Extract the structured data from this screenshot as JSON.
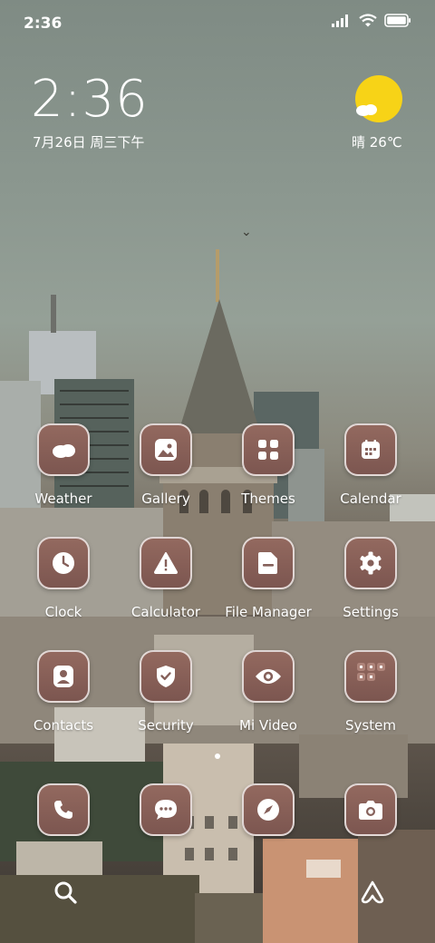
{
  "status_bar": {
    "time": "2:36",
    "battery_level": 1.0
  },
  "clock_widget": {
    "time": "2:36",
    "date": "7月26日 周三下午"
  },
  "weather_widget": {
    "text": "晴 26℃",
    "icon": "sun-cloud-icon",
    "sun_color": "#f7d317"
  },
  "apps": [
    {
      "label": "Weather",
      "icon": "cloud-icon"
    },
    {
      "label": "Gallery",
      "icon": "image-icon"
    },
    {
      "label": "Themes",
      "icon": "grid-squares-icon"
    },
    {
      "label": "Calendar",
      "icon": "calendar-icon"
    },
    {
      "label": "Clock",
      "icon": "clock-icon"
    },
    {
      "label": "Calculator",
      "icon": "warning-triangle-icon"
    },
    {
      "label": "File Manager",
      "icon": "folder-icon"
    },
    {
      "label": "Settings",
      "icon": "gear-icon"
    },
    {
      "label": "Contacts",
      "icon": "person-icon"
    },
    {
      "label": "Security",
      "icon": "shield-icon"
    },
    {
      "label": "Mi Video",
      "icon": "eye-icon"
    },
    {
      "label": "System",
      "icon": "folder-group-icon"
    }
  ],
  "dock": [
    {
      "icon": "phone-icon"
    },
    {
      "icon": "message-icon"
    },
    {
      "icon": "compass-icon"
    },
    {
      "icon": "camera-icon"
    }
  ],
  "bottom_bar": {
    "left_icon": "search-icon",
    "right_icon": "ai-assistant-icon"
  },
  "colors": {
    "tile": "#85605a",
    "tile_border": "#ffffff"
  }
}
